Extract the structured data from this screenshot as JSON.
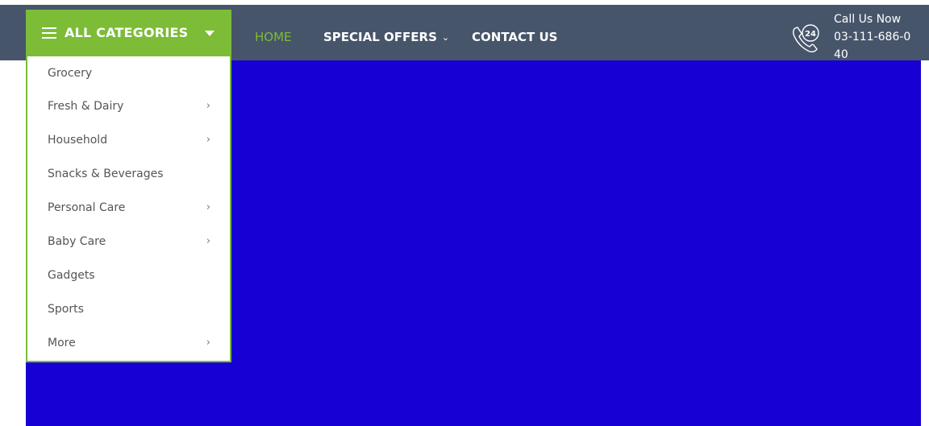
{
  "categories_menu": {
    "title": "ALL CATEGORIES",
    "items": [
      {
        "label": "Grocery",
        "has_submenu": false
      },
      {
        "label": "Fresh & Dairy",
        "has_submenu": true
      },
      {
        "label": "Household",
        "has_submenu": true
      },
      {
        "label": "Snacks & Beverages",
        "has_submenu": false
      },
      {
        "label": "Personal Care",
        "has_submenu": true
      },
      {
        "label": "Baby Care",
        "has_submenu": true
      },
      {
        "label": "Gadgets",
        "has_submenu": false
      },
      {
        "label": "Sports",
        "has_submenu": false
      },
      {
        "label": "More",
        "has_submenu": true
      }
    ]
  },
  "nav": {
    "home": "HOME",
    "special_offers": "SPECIAL OFFERS",
    "contact_us": "CONTACT US"
  },
  "call": {
    "label": "Call Us Now",
    "number": "03-111-686-040",
    "icon_text": "24"
  },
  "icons": {
    "menu": "hamburger-icon",
    "dropdown": "caret-down-icon",
    "offers_dropdown": "chevron-down-icon",
    "submenu": "chevron-right-icon",
    "phone": "phone-24-icon"
  },
  "colors": {
    "navbar": "#47556b",
    "accent_green": "#7cbc37",
    "hero_blue": "#1600d4",
    "menu_text": "#555555"
  }
}
